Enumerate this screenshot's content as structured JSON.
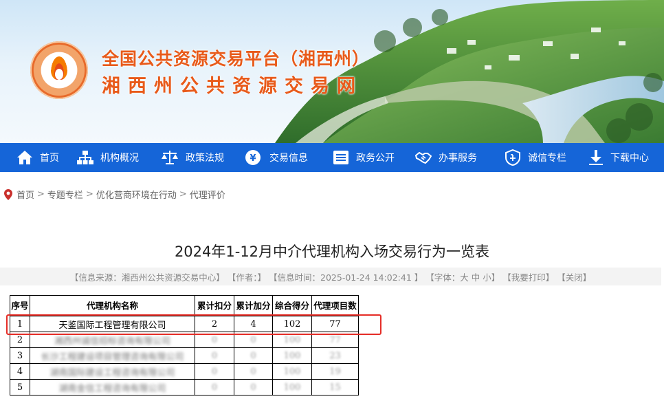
{
  "banner": {
    "title": "全国公共资源交易平台（湘西州）",
    "subtitle": "湘西州公共资源交易网"
  },
  "nav": {
    "items": [
      {
        "label": "首页",
        "icon": "home-icon"
      },
      {
        "label": "机构概况",
        "icon": "org-chart-icon"
      },
      {
        "label": "政策法规",
        "icon": "scales-icon"
      },
      {
        "label": "交易信息",
        "icon": "coin-icon"
      },
      {
        "label": "政务公开",
        "icon": "document-icon"
      },
      {
        "label": "办事服务",
        "icon": "handshake-icon"
      },
      {
        "label": "诚信专栏",
        "icon": "shield-icon"
      },
      {
        "label": "下载中心",
        "icon": "download-icon"
      }
    ]
  },
  "breadcrumb": {
    "items": [
      "首页",
      "专题专栏",
      "优化营商环境在行动",
      "代理评价"
    ],
    "separator": ">"
  },
  "article": {
    "title": "2024年1-12月中介代理机构入场交易行为一览表",
    "meta": {
      "source": "【信息来源：湘西州公共资源交易中心】",
      "author": "【作者：】",
      "time": "【信息时间：2025-01-24 14:02:41 】",
      "font": "【字体：大 中 小】",
      "print": "【我要打印】",
      "close": "【关闭】"
    }
  },
  "table": {
    "headers": [
      "序号",
      "代理机构名称",
      "累计扣分",
      "累计加分",
      "综合得分",
      "代理项目数"
    ],
    "rows": [
      {
        "no": "1",
        "name": "天鉴国际工程管理有限公司",
        "deduct": "2",
        "add": "4",
        "score": "102",
        "projects": "77"
      },
      {
        "no": "2",
        "name": "湘西州诚信招标咨询有限公司",
        "deduct": "0",
        "add": "0",
        "score": "100",
        "projects": "77"
      },
      {
        "no": "3",
        "name": "长沙工程建设项目管理咨询有限公司",
        "deduct": "0",
        "add": "0",
        "score": "100",
        "projects": "23"
      },
      {
        "no": "4",
        "name": "湖南国际建设工程咨询有限公司",
        "deduct": "0",
        "add": "0",
        "score": "100",
        "projects": "19"
      },
      {
        "no": "5",
        "name": "湖南金信工程咨询有限公司",
        "deduct": "0",
        "add": "0",
        "score": "100",
        "projects": "15"
      }
    ]
  },
  "colors": {
    "nav_bg": "#1565d8",
    "title_orange": "#e85a1a",
    "highlight_red": "#e52d27"
  }
}
